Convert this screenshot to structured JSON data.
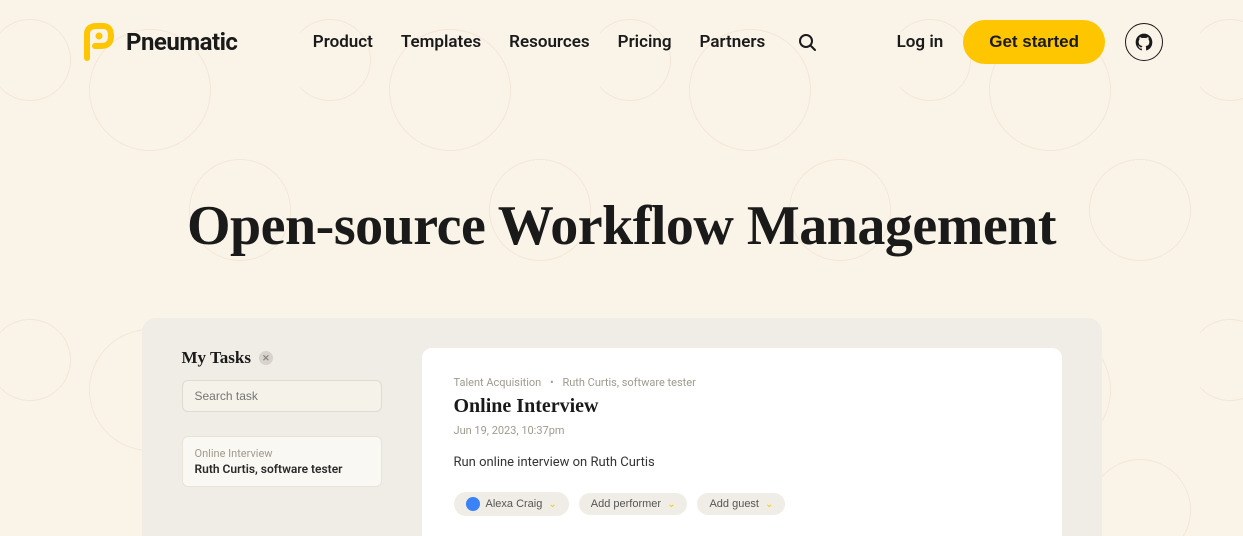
{
  "brand": {
    "name": "Pneumatic"
  },
  "nav": {
    "items": [
      "Product",
      "Templates",
      "Resources",
      "Pricing",
      "Partners"
    ]
  },
  "header": {
    "login": "Log in",
    "cta": "Get started"
  },
  "hero": {
    "title": "Open-source Workflow Management"
  },
  "tasks": {
    "title": "My Tasks",
    "search_placeholder": "Search task",
    "card": {
      "title": "Online Interview",
      "subtitle": "Ruth Curtis, software tester"
    }
  },
  "detail": {
    "breadcrumb_category": "Talent Acquisition",
    "breadcrumb_person": "Ruth Curtis, software tester",
    "title": "Online Interview",
    "date": "Jun 19, 2023, 10:37pm",
    "description": "Run online interview on Ruth Curtis",
    "performer": "Alexa Craig",
    "add_performer": "Add performer",
    "add_guest": "Add guest"
  }
}
